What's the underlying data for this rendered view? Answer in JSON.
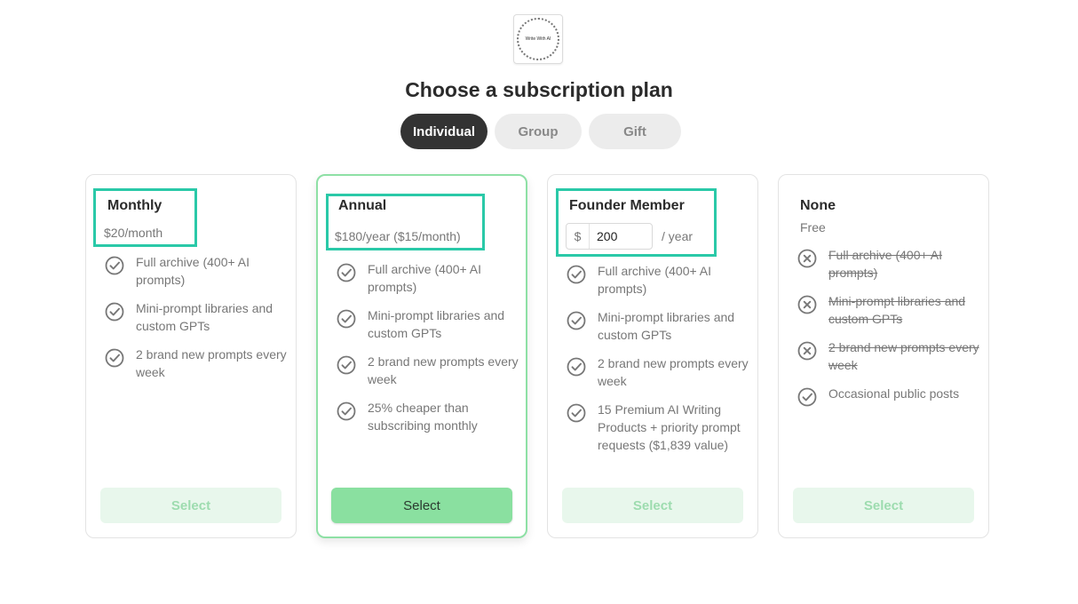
{
  "logo_text": "Write With AI",
  "title": "Choose a subscription plan",
  "tabs": [
    {
      "label": "Individual"
    },
    {
      "label": "Group"
    },
    {
      "label": "Gift"
    }
  ],
  "plans": [
    {
      "name": "Monthly",
      "price": "$20/month",
      "features": [
        {
          "text": "Full archive (400+ AI prompts)",
          "included": true
        },
        {
          "text": "Mini-prompt libraries and custom GPTs",
          "included": true
        },
        {
          "text": "2 brand new prompts every week",
          "included": true
        }
      ],
      "button": "Select"
    },
    {
      "name": "Annual",
      "price": "$180/year ($15/month)",
      "features": [
        {
          "text": "Full archive (400+ AI prompts)",
          "included": true
        },
        {
          "text": "Mini-prompt libraries and custom GPTs",
          "included": true
        },
        {
          "text": "2 brand new prompts every week",
          "included": true
        },
        {
          "text": "25% cheaper than subscribing monthly",
          "included": true
        }
      ],
      "button": "Select"
    },
    {
      "name": "Founder Member",
      "currency": "$",
      "amount": "200",
      "period": "/ year",
      "features": [
        {
          "text": "Full archive (400+ AI prompts)",
          "included": true
        },
        {
          "text": "Mini-prompt libraries and custom GPTs",
          "included": true
        },
        {
          "text": "2 brand new prompts every week",
          "included": true
        },
        {
          "text": "15 Premium AI Writing Products + priority prompt requests ($1,839 value)",
          "included": true
        }
      ],
      "button": "Select"
    },
    {
      "name": "None",
      "price": "Free",
      "features": [
        {
          "text": "Full archive (400+ AI prompts)",
          "included": false
        },
        {
          "text": "Mini-prompt libraries and custom GPTs",
          "included": false
        },
        {
          "text": "2 brand new prompts every week",
          "included": false
        },
        {
          "text": "Occasional public posts",
          "included": true
        }
      ],
      "button": "Select"
    }
  ],
  "colors": {
    "accent_green": "#8ae0a0",
    "highlight_teal": "#2ac9a8",
    "active_tab": "#333333"
  },
  "icons": {
    "included": "check-circle-icon",
    "excluded": "x-circle-icon"
  }
}
